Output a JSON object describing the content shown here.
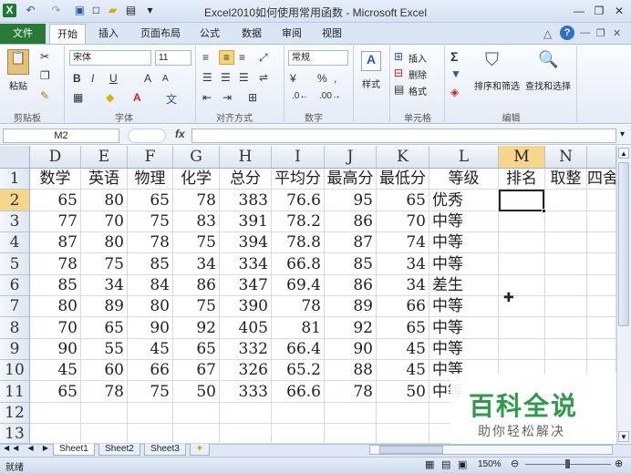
{
  "window": {
    "title": "Excel2010如何使用常用函数 - Microsoft Excel"
  },
  "tabs": {
    "file": "文件",
    "items": [
      "开始",
      "插入",
      "页面布局",
      "公式",
      "数据",
      "审阅",
      "视图"
    ]
  },
  "ribbon": {
    "clipboard": {
      "label": "剪贴板",
      "paste": "粘贴"
    },
    "font": {
      "label": "字体",
      "name": "宋体",
      "size": "11",
      "bold": "B",
      "italic": "I",
      "underline": "U",
      "grow": "A",
      "shrink": "A"
    },
    "alignment": {
      "label": "对齐方式"
    },
    "number": {
      "label": "数字",
      "format": "常规",
      "percent": "%",
      "comma": ","
    },
    "styles": {
      "label": "样式",
      "button": "样式"
    },
    "cells": {
      "label": "单元格",
      "insert": "插入",
      "delete": "删除",
      "format": "格式"
    },
    "editing": {
      "label": "编辑",
      "sort": "排序和筛选",
      "find": "查找和选择",
      "sigma": "Σ"
    }
  },
  "formula_bar": {
    "name_box": "M2",
    "fx": "fx",
    "value": ""
  },
  "columns": [
    "D",
    "E",
    "F",
    "G",
    "H",
    "I",
    "J",
    "K",
    "L",
    "M",
    "N",
    ""
  ],
  "rows": [
    "1",
    "2",
    "3",
    "4",
    "5",
    "6",
    "7",
    "8",
    "9",
    "10",
    "11",
    "12",
    "13"
  ],
  "header_row": [
    "数学",
    "英语",
    "物理",
    "化学",
    "总分",
    "平均分",
    "最高分",
    "最低分",
    "等级",
    "排名",
    "取整",
    "四舍"
  ],
  "data_rows": [
    [
      "65",
      "80",
      "65",
      "78",
      "383",
      "76.6",
      "95",
      "65",
      "优秀"
    ],
    [
      "77",
      "70",
      "75",
      "83",
      "391",
      "78.2",
      "86",
      "70",
      "中等"
    ],
    [
      "87",
      "80",
      "78",
      "75",
      "394",
      "78.8",
      "87",
      "74",
      "中等"
    ],
    [
      "78",
      "75",
      "85",
      "34",
      "334",
      "66.8",
      "85",
      "34",
      "中等"
    ],
    [
      "85",
      "34",
      "84",
      "86",
      "347",
      "69.4",
      "86",
      "34",
      "差生"
    ],
    [
      "80",
      "89",
      "80",
      "75",
      "390",
      "78",
      "89",
      "66",
      "中等"
    ],
    [
      "70",
      "65",
      "90",
      "92",
      "405",
      "81",
      "92",
      "65",
      "中等"
    ],
    [
      "90",
      "55",
      "45",
      "65",
      "332",
      "66.4",
      "90",
      "45",
      "中等"
    ],
    [
      "45",
      "60",
      "66",
      "67",
      "326",
      "65.2",
      "88",
      "45",
      "中等"
    ],
    [
      "65",
      "78",
      "75",
      "50",
      "333",
      "66.6",
      "78",
      "50",
      "中等"
    ]
  ],
  "sheets": [
    "Sheet1",
    "Sheet2",
    "Sheet3"
  ],
  "status": {
    "ready": "就绪",
    "zoom": "150%"
  },
  "watermark": {
    "main": "百科全说",
    "sub": "助你轻松解决"
  }
}
